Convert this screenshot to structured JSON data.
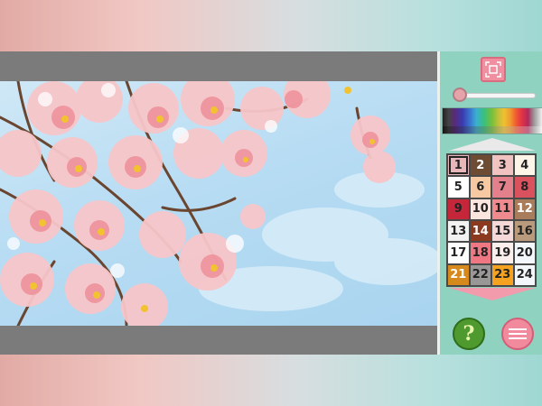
{
  "palette": {
    "fit_icon": "fit-screen-icon",
    "zoom_level": 0.05,
    "help_label": "?",
    "menu_icon": "hamburger-menu-icon",
    "cells": [
      {
        "num": "1",
        "color": "#e9b6b9",
        "text": "#222"
      },
      {
        "num": "2",
        "color": "#6e4c34",
        "text": "#fff"
      },
      {
        "num": "3",
        "color": "#f0c2c0",
        "text": "#222"
      },
      {
        "num": "4",
        "color": "#fdf5e7",
        "text": "#222"
      },
      {
        "num": "5",
        "color": "#ffffff",
        "text": "#222"
      },
      {
        "num": "6",
        "color": "#f7c9a2",
        "text": "#222"
      },
      {
        "num": "7",
        "color": "#e4808c",
        "text": "#222"
      },
      {
        "num": "8",
        "color": "#d9525e",
        "text": "#222"
      },
      {
        "num": "9",
        "color": "#c5263a",
        "text": "#222"
      },
      {
        "num": "10",
        "color": "#fbe6df",
        "text": "#222"
      },
      {
        "num": "11",
        "color": "#ef8b8f",
        "text": "#222"
      },
      {
        "num": "12",
        "color": "#a97c5c",
        "text": "#fff"
      },
      {
        "num": "13",
        "color": "#f2f2f2",
        "text": "#222"
      },
      {
        "num": "14",
        "color": "#8b3a1f",
        "text": "#fff"
      },
      {
        "num": "15",
        "color": "#f5d9d8",
        "text": "#222"
      },
      {
        "num": "16",
        "color": "#b99a7c",
        "text": "#222"
      },
      {
        "num": "17",
        "color": "#fdfdfd",
        "text": "#222"
      },
      {
        "num": "18",
        "color": "#ef7784",
        "text": "#222"
      },
      {
        "num": "19",
        "color": "#fbefee",
        "text": "#222"
      },
      {
        "num": "20",
        "color": "#f3f6fb",
        "text": "#222"
      },
      {
        "num": "21",
        "color": "#d68a1e",
        "text": "#fff"
      },
      {
        "num": "22",
        "color": "#9a9797",
        "text": "#222"
      },
      {
        "num": "23",
        "color": "#f4a21f",
        "text": "#222"
      },
      {
        "num": "24",
        "color": "#f3f6fa",
        "text": "#222"
      }
    ],
    "selected": "1"
  },
  "colors": {
    "panel_bg": "#8fd2c0",
    "frame_gray": "#7b7b7b",
    "sky": "#b7dcf3",
    "blossom_pink": "#f2a5ad",
    "branch_brown": "#6a4630"
  }
}
